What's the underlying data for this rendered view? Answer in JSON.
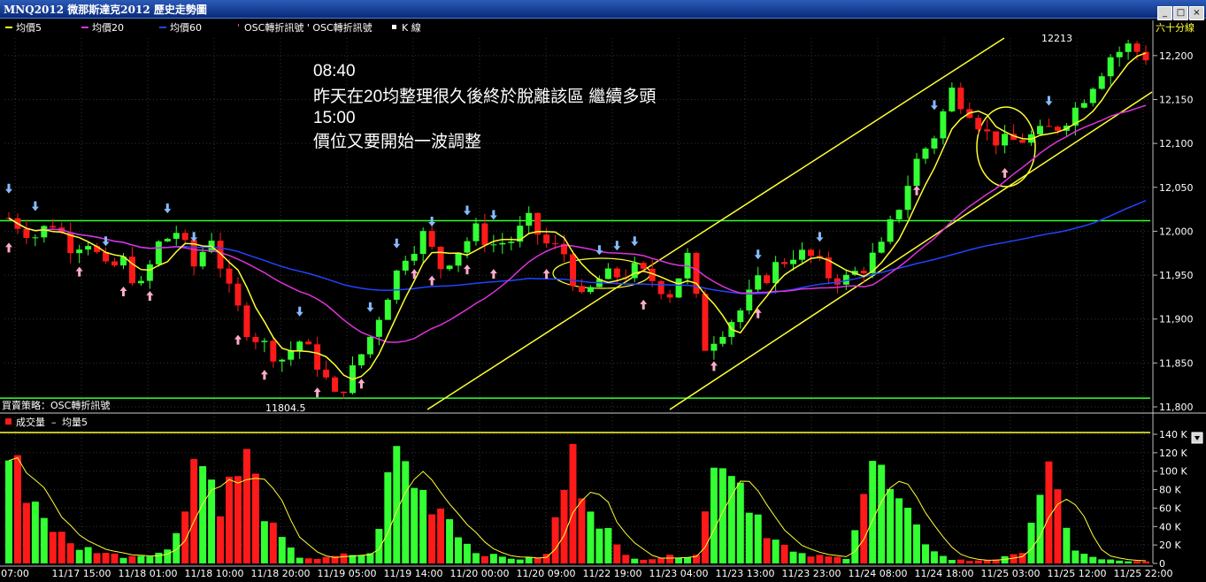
{
  "window": {
    "title": "MNQ2012 微那斯達克2012  歷史走勢圖"
  },
  "legend": {
    "ma5": "均價5",
    "ma20": "均價20",
    "ma60": "均價60",
    "osc_signals": "OSC轉折訊號 ' OSC轉折訊號",
    "kline": "K 線"
  },
  "period_label": "六十分線",
  "strategy_label": "買賣策略：OSC轉折訊號",
  "volume_legend": {
    "volume": "成交量",
    "avg": "均量5"
  },
  "annotation": {
    "line1": "08:40",
    "line2": "昨天在20均整理很久後終於脫離該區 繼續多頭",
    "line3": "15:00",
    "line4": "價位又要開始一波調整"
  },
  "low_label": "11804.5",
  "high_label": "12213",
  "colors": {
    "up": "#33ff33",
    "down": "#ff1a1a",
    "ma5": "#ffff33",
    "ma20": "#dd33dd",
    "ma60": "#2244ff",
    "grid": "#333333"
  },
  "chart_data": {
    "type": "candlestick",
    "price_axis": {
      "ylim": [
        11800,
        12220
      ],
      "ticks": [
        "11,800",
        "11,850",
        "11,900",
        "11,950",
        "12,000",
        "12,050",
        "12,100",
        "12,150",
        "12,200"
      ]
    },
    "volume_axis": {
      "ylim": [
        0,
        140
      ],
      "unit": "K",
      "ticks": [
        "0",
        "20 K",
        "40 K",
        "60 K",
        "80 K",
        "100 K",
        "120 K",
        "140 K"
      ]
    },
    "x_ticks": [
      "07:00",
      "11/17 15:00",
      "11/18 01:00",
      "11/18 10:00",
      "11/18 20:00",
      "11/19 05:00",
      "11/19 14:00",
      "11/20 00:00",
      "11/20 09:00",
      "11/22 19:00",
      "11/23 04:00",
      "11/23 13:00",
      "11/23 23:00",
      "11/24 08:00",
      "11/24 18:00",
      "11/25 03:00",
      "11/25 12:00",
      "11/25 22:00"
    ],
    "horizontal_levels": [
      12012,
      11810
    ],
    "price_anchors": [
      [
        0,
        12015
      ],
      [
        3,
        11995
      ],
      [
        5,
        12010
      ],
      [
        7,
        11985
      ],
      [
        9,
        11990
      ],
      [
        11,
        11955
      ],
      [
        13,
        11965
      ],
      [
        15,
        11935
      ],
      [
        17,
        11985
      ],
      [
        19,
        12000
      ],
      [
        21,
        11960
      ],
      [
        23,
        11995
      ],
      [
        25,
        11930
      ],
      [
        27,
        11890
      ],
      [
        29,
        11870
      ],
      [
        31,
        11855
      ],
      [
        33,
        11875
      ],
      [
        35,
        11850
      ],
      [
        37,
        11810
      ],
      [
        39,
        11840
      ],
      [
        41,
        11880
      ],
      [
        43,
        11930
      ],
      [
        45,
        11975
      ],
      [
        47,
        11995
      ],
      [
        49,
        11960
      ],
      [
        51,
        11980
      ],
      [
        53,
        12000
      ],
      [
        55,
        11985
      ],
      [
        57,
        11990
      ],
      [
        59,
        12010
      ],
      [
        61,
        11985
      ],
      [
        63,
        11975
      ],
      [
        65,
        11920
      ],
      [
        67,
        11945
      ],
      [
        69,
        11950
      ],
      [
        71,
        11955
      ],
      [
        73,
        11945
      ],
      [
        75,
        11930
      ],
      [
        77,
        11970
      ],
      [
        79,
        11870
      ],
      [
        81,
        11890
      ],
      [
        83,
        11910
      ],
      [
        85,
        11940
      ],
      [
        87,
        11960
      ],
      [
        89,
        11975
      ],
      [
        91,
        11970
      ],
      [
        93,
        11950
      ],
      [
        95,
        11945
      ],
      [
        97,
        11960
      ],
      [
        99,
        11980
      ],
      [
        101,
        12030
      ],
      [
        103,
        12080
      ],
      [
        105,
        12110
      ],
      [
        107,
        12160
      ],
      [
        109,
        12140
      ],
      [
        111,
        12110
      ],
      [
        113,
        12100
      ],
      [
        115,
        12105
      ],
      [
        117,
        12110
      ],
      [
        119,
        12120
      ],
      [
        121,
        12140
      ],
      [
        123,
        12170
      ],
      [
        125,
        12200
      ],
      [
        127,
        12210
      ],
      [
        129,
        12200
      ]
    ],
    "volume_anchors": [
      [
        0,
        120
      ],
      [
        3,
        50
      ],
      [
        5,
        20
      ],
      [
        7,
        15
      ],
      [
        9,
        8
      ],
      [
        11,
        10
      ],
      [
        13,
        15
      ],
      [
        15,
        130
      ],
      [
        17,
        70
      ],
      [
        19,
        120
      ],
      [
        21,
        40
      ],
      [
        23,
        8
      ],
      [
        25,
        5
      ],
      [
        27,
        10
      ],
      [
        29,
        10
      ],
      [
        31,
        130
      ],
      [
        33,
        80
      ],
      [
        35,
        60
      ],
      [
        37,
        15
      ],
      [
        39,
        8
      ],
      [
        41,
        5
      ],
      [
        43,
        8
      ],
      [
        45,
        120
      ],
      [
        47,
        60
      ],
      [
        49,
        10
      ],
      [
        51,
        5
      ],
      [
        53,
        8
      ],
      [
        55,
        10
      ],
      [
        57,
        140
      ],
      [
        59,
        80
      ],
      [
        61,
        30
      ],
      [
        63,
        10
      ],
      [
        65,
        8
      ],
      [
        67,
        6
      ],
      [
        69,
        120
      ],
      [
        71,
        70
      ],
      [
        73,
        30
      ],
      [
        75,
        5
      ],
      [
        77,
        3
      ],
      [
        79,
        5
      ],
      [
        81,
        10
      ],
      [
        83,
        110
      ],
      [
        85,
        20
      ],
      [
        87,
        5
      ],
      [
        89,
        3
      ],
      [
        91,
        2
      ]
    ],
    "buy_signal_bars": [
      0,
      8,
      13,
      16,
      26,
      29,
      35,
      40,
      46,
      48,
      52,
      55,
      61,
      72,
      80,
      85,
      103,
      113
    ],
    "sell_signal_bars": [
      0,
      3,
      11,
      18,
      21,
      33,
      41,
      44,
      48,
      52,
      55,
      67,
      69,
      71,
      85,
      92,
      105,
      118
    ],
    "series": [
      {
        "name": "均價5",
        "type": "line"
      },
      {
        "name": "均價20",
        "type": "line"
      },
      {
        "name": "均價60",
        "type": "line"
      },
      {
        "name": "成交量",
        "type": "bar"
      },
      {
        "name": "均量5",
        "type": "line"
      }
    ]
  }
}
